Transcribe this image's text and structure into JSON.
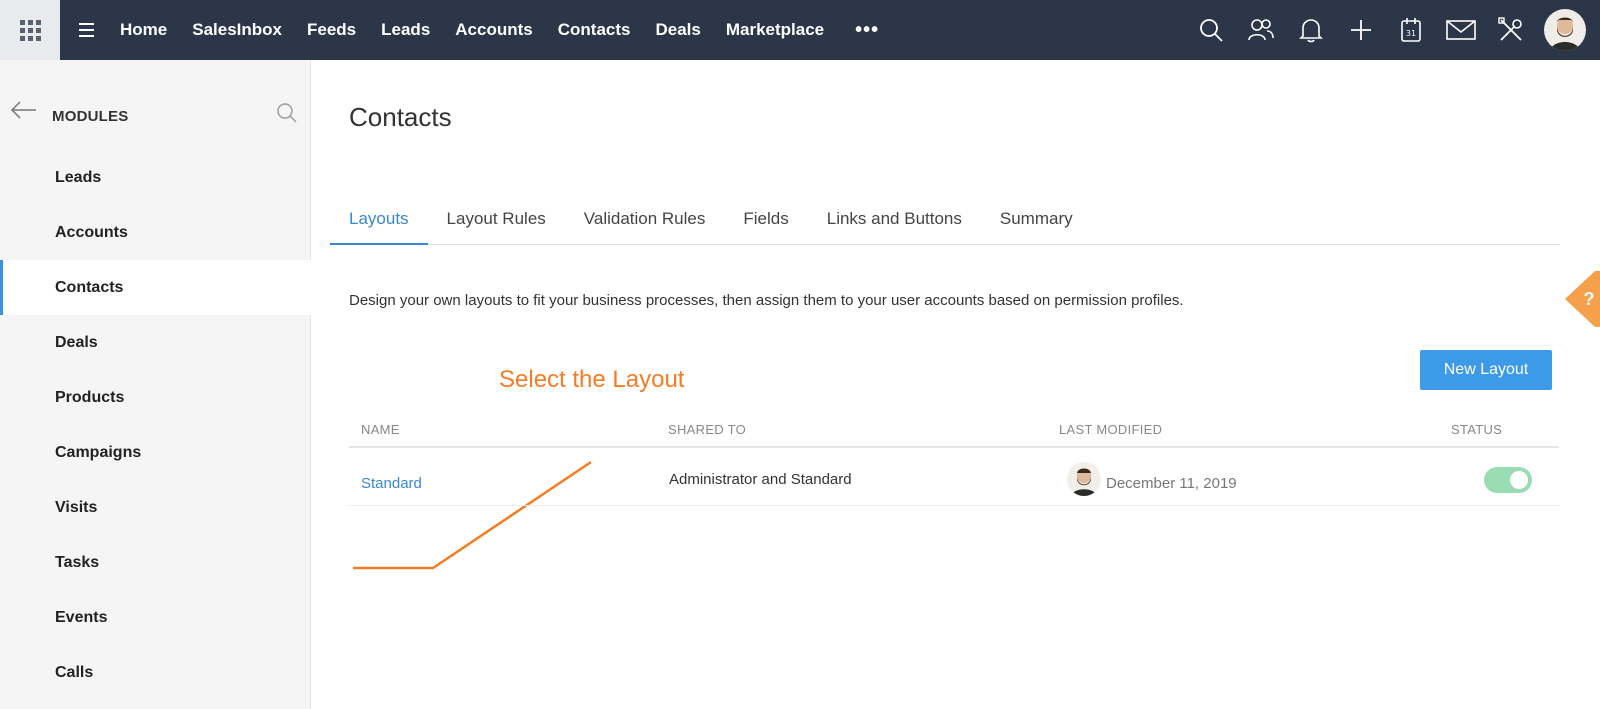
{
  "topbar": {
    "nav_items": [
      "Home",
      "SalesInbox",
      "Feeds",
      "Leads",
      "Accounts",
      "Contacts",
      "Deals",
      "Marketplace"
    ],
    "more_label": "•••",
    "colors": {
      "bar_bg": "#2b3648",
      "apps_bg": "#e8eaee"
    }
  },
  "sidebar": {
    "title": "MODULES",
    "items": [
      "Leads",
      "Accounts",
      "Contacts",
      "Deals",
      "Products",
      "Campaigns",
      "Visits",
      "Tasks",
      "Events",
      "Calls"
    ],
    "active_index": 2
  },
  "main": {
    "title": "Contacts",
    "tabs": [
      "Layouts",
      "Layout Rules",
      "Validation Rules",
      "Fields",
      "Links and Buttons",
      "Summary"
    ],
    "active_tab": 0,
    "description": "Design your own layouts to fit your business processes, then assign them to your user accounts based on permission profiles.",
    "new_button": "New Layout",
    "annotation": "Select the Layout",
    "table": {
      "headers": {
        "name": "NAME",
        "shared": "SHARED TO",
        "modified": "LAST MODIFIED",
        "status": "STATUS"
      },
      "rows": [
        {
          "name": "Standard",
          "shared": "Administrator and Standard",
          "modified": "December 11, 2019",
          "status_on": true
        }
      ]
    },
    "colors": {
      "accent": "#3a87d3",
      "button": "#3d9ae8",
      "annotation": "#f57c22",
      "toggle_on": "#9adcb4",
      "help": "#f5a04a"
    }
  }
}
